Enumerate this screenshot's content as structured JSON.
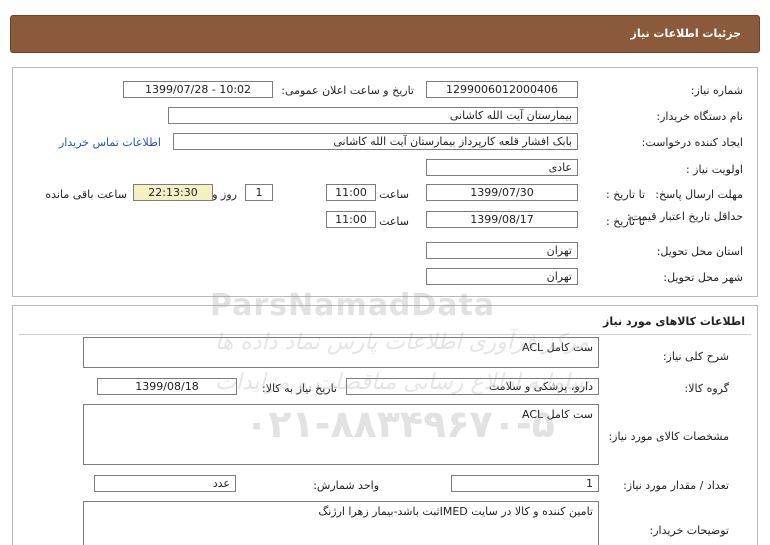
{
  "header": {
    "title": "جزئیات اطلاعات نیاز"
  },
  "need_info": {
    "need_number_label": "شماره نیاز:",
    "need_number": "1299006012000406",
    "announce_label": "تاریخ و ساعت اعلان عمومی:",
    "announce_value": "1399/07/28 - 10:02",
    "buyer_org_label": "نام دستگاه خریدار:",
    "buyer_org": "بیمارستان آیت الله کاشانی",
    "requester_label": "ایجاد کننده درخواست:",
    "requester": "بابک افشار قلعه کارپرداز بیمارستان آیت الله کاشانی",
    "contact_link": "اطلاعات تماس خریدار",
    "priority_label": "اولویت نیاز :",
    "priority": "عادی",
    "reply_deadline_label": "مهلت ارسال پاسخ:",
    "to_date_label": "تا تاریخ :",
    "reply_date": "1399/07/30",
    "time_label": "ساعت",
    "reply_time": "11:00",
    "days_value": "1",
    "days_label": "روز و",
    "remaining_time": "22:13:30",
    "remaining_label": "ساعت باقی مانده",
    "price_validity_label": "حداقل تاریخ اعتبار قیمت:",
    "validity_date": "1399/08/17",
    "validity_time": "11:00",
    "province_label": "استان محل تحویل:",
    "province": "تهران",
    "city_label": "شهر محل تحویل:",
    "city": "تهران"
  },
  "goods": {
    "section_title": "اطلاعات کالاهای مورد نیاز",
    "desc_label": "شرح کلی نیاز:",
    "desc": "ست کامل ACL",
    "group_label": "گروه کالا:",
    "group": "دارو، پزشکی و سلامت",
    "need_date_label": "تاریخ نیاز به کالا:",
    "need_date": "1399/08/18",
    "specs_label": "مشخصات کالای مورد نیاز:",
    "specs": "ست کامل ACL",
    "qty_label": "تعداد / مقدار مورد نیاز:",
    "qty": "1",
    "unit_label": "واحد شمارش:",
    "unit": "عدد",
    "buyer_notes_label": "توضیحات خریدار:",
    "buyer_notes": "تامین کننده و کالا در سایت IMEDثبت باشد-بیمار زهرا ارژنگ"
  },
  "watermark": {
    "brand": "ParsNamadData",
    "line1": "مرکز فرآوری اطلاعات پارس نماد داده ها",
    "line2": "سامانه اطلاع رسانی مناقصات و مزایدات",
    "phone": "۰۲۱-۸۸۳۴۹۶۷۰-۵"
  }
}
